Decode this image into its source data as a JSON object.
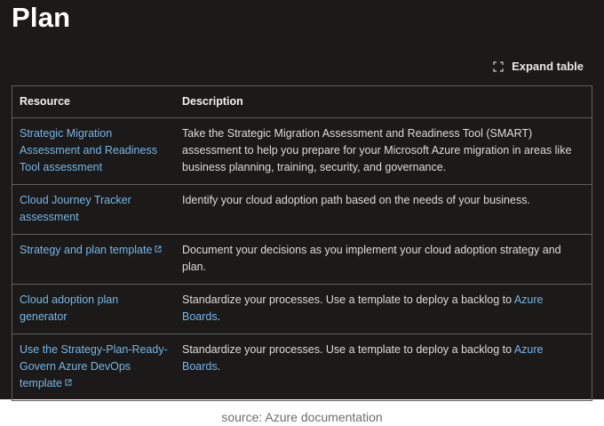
{
  "page": {
    "title": "Plan",
    "expand_label": "Expand table"
  },
  "table": {
    "headers": {
      "resource": "Resource",
      "description": "Description"
    },
    "rows": [
      {
        "resource": "Strategic Migration Assessment and Readiness Tool assessment",
        "external": false,
        "description": "Take the Strategic Migration Assessment and Readiness Tool (SMART) assessment to help you prepare for your Microsoft Azure migration in areas like business planning, training, security, and governance.",
        "description_link": ""
      },
      {
        "resource": "Cloud Journey Tracker assessment",
        "external": false,
        "description": "Identify your cloud adoption path based on the needs of your business.",
        "description_link": ""
      },
      {
        "resource": "Strategy and plan template",
        "external": true,
        "description": "Document your decisions as you implement your cloud adoption strategy and plan.",
        "description_link": ""
      },
      {
        "resource": "Cloud adoption plan generator",
        "external": false,
        "description": "Standardize your processes. Use a template to deploy a backlog to ",
        "description_link": "Azure Boards",
        "description_suffix": "."
      },
      {
        "resource": "Use the Strategy-Plan-Ready-Govern Azure DevOps template",
        "external": true,
        "description": "Standardize your processes. Use a template to deploy a backlog to ",
        "description_link": "Azure Boards",
        "description_suffix": "."
      }
    ]
  },
  "caption": "source: Azure documentation",
  "colors": {
    "background": "#1b1a19",
    "link": "#75b6e7",
    "border": "#5e5e5e"
  },
  "icons": {
    "expand": "expand-icon",
    "external": "external-link-icon"
  }
}
